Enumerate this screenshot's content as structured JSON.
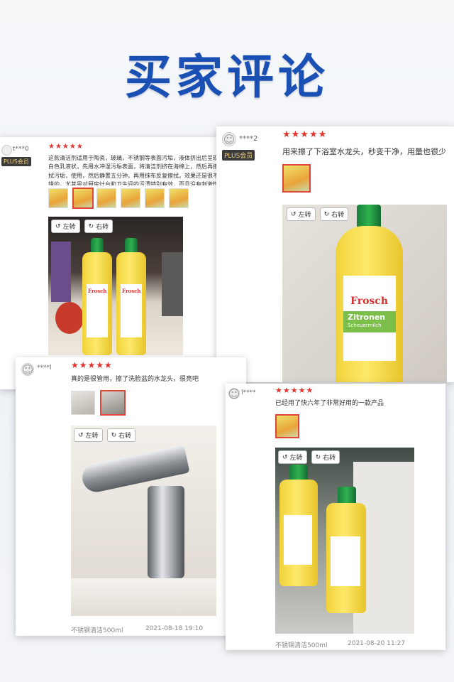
{
  "page": {
    "title": "买家评论"
  },
  "rotate": {
    "left": "左转",
    "right": "右转"
  },
  "reviews": [
    {
      "user": "t***0",
      "badge": "PLUS会员",
      "stars": "★★★★★",
      "text": "这款清洁剂适用于陶瓷，玻璃，不锈钢等表面污垢，液体挤出后呈现白色乳液状，先用水冲湿污垢表面，将清洁剂挤在海绵上，然后再擦拭污垢，使用，然后静置五分钟，再用抹布反复擦拭。效果还是很不错的，尤其是对厨房灶台和卫生间的污渍特别有效，而且没有刺激性气味。推荐大家购买，适合每个家庭的人。"
    },
    {
      "user": "****2",
      "badge": "PLUS会员",
      "stars": "★★★★★",
      "text": "用来擦了下浴室水龙头，秒变干净，用量也很少"
    },
    {
      "user": "****l",
      "stars": "★★★★★",
      "text": "真的是很管用，擦了洗脸盆的水龙头，很亮吧",
      "product": "不锈钢清洁500ml",
      "date": "2021-08-18 19:10"
    },
    {
      "user": "l****",
      "stars": "★★★★★",
      "text": "已经用了快六年了非常好用的一款产品",
      "product": "不锈钢清洁500ml",
      "date": "2021-08-20 11:27"
    }
  ],
  "bottle": {
    "brand": "Frosch",
    "name": "Zitronen",
    "sub": "Scheuermilch"
  },
  "colors": {
    "title": "#1a4fb4",
    "stars": "#e3322c",
    "cap": "#1f8c3f",
    "bottle": "#f7dc45"
  }
}
